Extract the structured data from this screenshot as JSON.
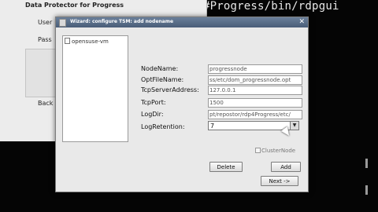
{
  "terminal": {
    "text": "#Progress/bin/rdpgui"
  },
  "background_window": {
    "title": "Data Protector for Progress",
    "label1": "User",
    "label2": "Pass",
    "label3": "Back"
  },
  "dialog": {
    "title": "Wizard: configure TSM: add nodename",
    "list_items": [
      "opensuse-vm"
    ],
    "fields": [
      {
        "label": "NodeName:",
        "value": "progressnode"
      },
      {
        "label": "OptFileName:",
        "value": "ss/etc/dom_progressnode.opt"
      },
      {
        "label": "TcpServerAddress:",
        "value": "127.0.0.1"
      },
      {
        "label": "TcpPort:",
        "value": "1500"
      },
      {
        "label": "LogDir:",
        "value": "pt/repostor/rdp4Progress/etc/"
      },
      {
        "label": "LogRetention:",
        "value": "7"
      }
    ],
    "checkbox_label": "ClusterNode",
    "buttons": {
      "delete": "Delete",
      "add": "Add",
      "next": "Next ->"
    }
  }
}
